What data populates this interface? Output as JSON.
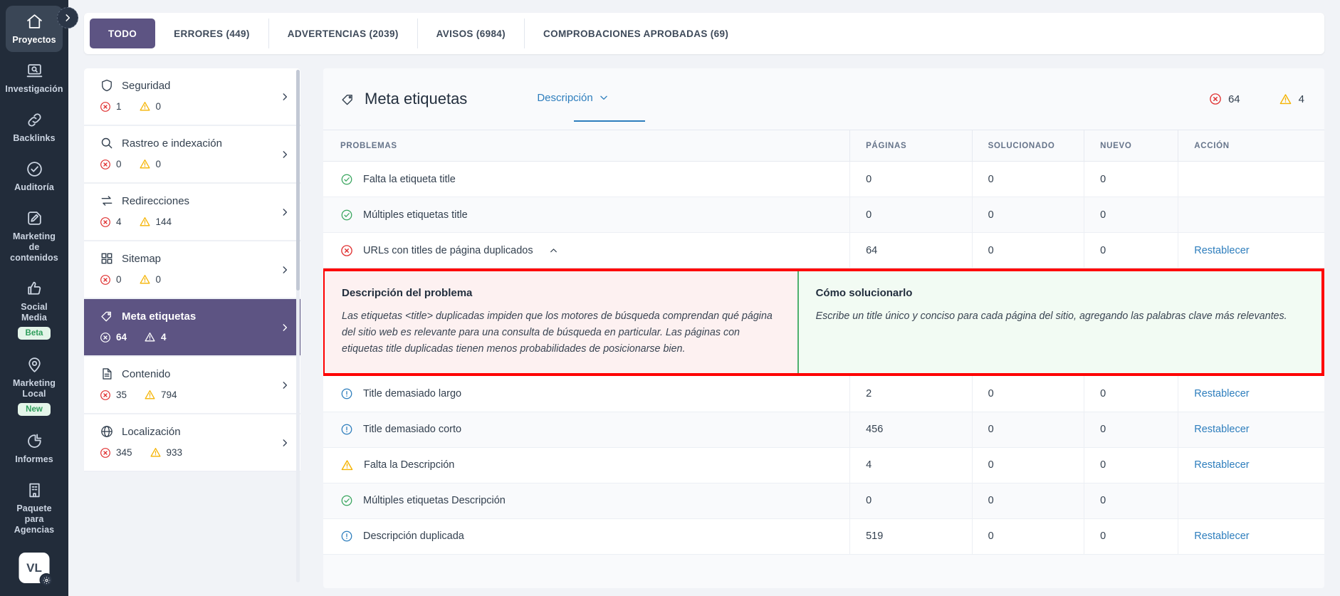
{
  "nav": {
    "items": [
      {
        "label": "Proyectos",
        "icon": "home-icon",
        "active": true,
        "badge": null
      },
      {
        "label": "Investigación",
        "icon": "research-magnifier-icon",
        "active": false,
        "badge": null
      },
      {
        "label": "Backlinks",
        "icon": "link-chain-icon",
        "active": false,
        "badge": null
      },
      {
        "label": "Auditoría",
        "icon": "check-circle-icon",
        "active": false,
        "badge": null
      },
      {
        "label": "Marketing de contenidos",
        "icon": "pencil-square-icon",
        "active": false,
        "badge": null
      },
      {
        "label": "Social Media",
        "icon": "thumbs-up-icon",
        "active": false,
        "badge": "Beta"
      },
      {
        "label": "Marketing Local",
        "icon": "map-pin-icon",
        "active": false,
        "badge": "New"
      },
      {
        "label": "Informes",
        "icon": "pie-chart-icon",
        "active": false,
        "badge": null
      },
      {
        "label": "Paquete para Agencias",
        "icon": "building-icon",
        "active": false,
        "badge": null
      }
    ],
    "avatar_initials": "VL",
    "collapse_icon": "chevron-right-icon"
  },
  "tabs": [
    {
      "label": "TODO",
      "active": true
    },
    {
      "label": "ERRORES (449)",
      "active": false
    },
    {
      "label": "ADVERTENCIAS (2039)",
      "active": false
    },
    {
      "label": "AVISOS (6984)",
      "active": false
    },
    {
      "label": "COMPROBACIONES APROBADAS (69)",
      "active": false
    }
  ],
  "categories": [
    {
      "name": "Seguridad",
      "icon": "shield-icon",
      "errors": "1",
      "warnings": "0",
      "selected": false
    },
    {
      "name": "Rastreo e indexación",
      "icon": "magnifier-icon",
      "errors": "0",
      "warnings": "0",
      "selected": false
    },
    {
      "name": "Redirecciones",
      "icon": "swap-arrows-icon",
      "errors": "4",
      "warnings": "144",
      "selected": false
    },
    {
      "name": "Sitemap",
      "icon": "grid-icon",
      "errors": "0",
      "warnings": "0",
      "selected": false
    },
    {
      "name": "Meta etiquetas",
      "icon": "tag-icon",
      "errors": "64",
      "warnings": "4",
      "selected": true
    },
    {
      "name": "Contenido",
      "icon": "document-icon",
      "errors": "35",
      "warnings": "794",
      "selected": false
    },
    {
      "name": "Localización",
      "icon": "globe-icon",
      "errors": "345",
      "warnings": "933",
      "selected": false
    }
  ],
  "panel": {
    "title": "Meta etiquetas",
    "title_icon": "tag-icon",
    "filter_label": "Descripción",
    "filter_caret": "chevron-down-icon",
    "error_count": "64",
    "warning_count": "4"
  },
  "table": {
    "columns": [
      "PROBLEMAS",
      "PÁGINAS",
      "SOLUCIONADO",
      "NUEVO",
      "ACCIÓN"
    ],
    "rows": [
      {
        "status": "ok",
        "issue": "Falta la etiqueta title",
        "pages": "0",
        "fixed": "0",
        "new": "0",
        "action": ""
      },
      {
        "status": "ok",
        "issue": "Múltiples etiquetas title",
        "pages": "0",
        "fixed": "0",
        "new": "0",
        "action": ""
      },
      {
        "status": "error",
        "issue": "URLs con titles de página duplicados",
        "pages": "64",
        "fixed": "0",
        "new": "0",
        "action": "Restablecer",
        "expanded": true
      },
      {
        "status": "notice",
        "issue": "Title demasiado largo",
        "pages": "2",
        "fixed": "0",
        "new": "0",
        "action": "Restablecer"
      },
      {
        "status": "notice",
        "issue": "Title demasiado corto",
        "pages": "456",
        "fixed": "0",
        "new": "0",
        "action": "Restablecer"
      },
      {
        "status": "warning",
        "issue": "Falta la Descripción",
        "pages": "4",
        "fixed": "0",
        "new": "0",
        "action": "Restablecer"
      },
      {
        "status": "ok",
        "issue": "Múltiples etiquetas Descripción",
        "pages": "0",
        "fixed": "0",
        "new": "0",
        "action": ""
      },
      {
        "status": "notice",
        "issue": "Descripción duplicada",
        "pages": "519",
        "fixed": "0",
        "new": "0",
        "action": "Restablecer"
      }
    ]
  },
  "explanation": {
    "problem_title": "Descripción del problema",
    "problem_body": "Las etiquetas <title> duplicadas impiden que los motores de búsqueda comprendan qué página del sitio web es relevante para una consulta de búsqueda en particular. Las páginas con etiquetas title duplicadas tienen menos probabilidades de posicionarse bien.",
    "fix_title": "Cómo solucionarlo",
    "fix_body": "Escribe un title único y conciso para cada página del sitio, agregando las palabras clave más relevantes."
  },
  "colors": {
    "accent_purple": "#5d5483",
    "error_red": "#e03131",
    "warning_yellow": "#f5b301",
    "ok_green": "#3aa65f",
    "link_blue": "#2e7ebd",
    "highlight_border": "#fe0000"
  }
}
